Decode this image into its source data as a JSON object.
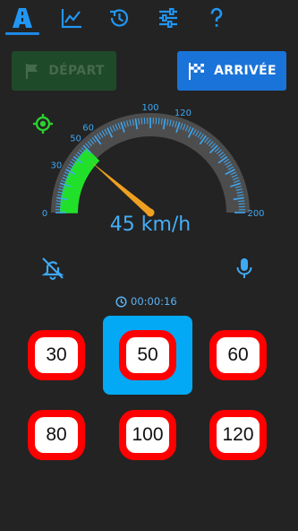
{
  "tabs": [
    {
      "name": "road-icon",
      "active": true
    },
    {
      "name": "chart-icon",
      "active": false
    },
    {
      "name": "history-icon",
      "active": false
    },
    {
      "name": "settings-sliders-icon",
      "active": false
    },
    {
      "name": "help-icon",
      "active": false
    }
  ],
  "buttons": {
    "depart_label": "DÉPART",
    "arrivee_label": "ARRIVÉE"
  },
  "gauge": {
    "min": 0,
    "max": 200,
    "current_speed": 45,
    "target_speed": 50,
    "tick_labels": [
      "0",
      "30",
      "50",
      "60",
      "100",
      "120",
      "200"
    ],
    "colors": {
      "zone": "#22e02a",
      "ticks": "#3ea9f5",
      "needle": "#f0a020",
      "track": "#4d4d4d"
    }
  },
  "speed_display": "45 km/h",
  "icons": {
    "gps": "gps-target-icon",
    "mute": "bell-off-icon",
    "mic": "microphone-icon"
  },
  "timer": "00:00:16",
  "speed_limits": [
    "30",
    "50",
    "60",
    "80",
    "100",
    "120"
  ],
  "selected_limit": "50",
  "colors": {
    "accent": "#03a9f4",
    "sign_red": "#ff0000",
    "background": "#232323"
  }
}
